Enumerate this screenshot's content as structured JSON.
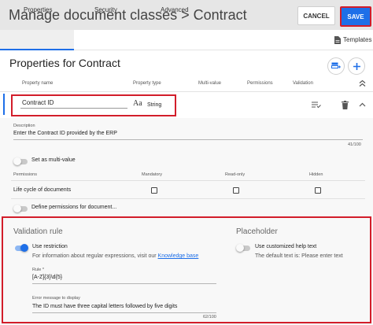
{
  "header": {
    "title": "Manage document classes > Contract",
    "cancel_label": "CANCEL",
    "save_label": "SAVE"
  },
  "tabs": [
    {
      "label": "Properties",
      "active": true
    },
    {
      "label": "Security",
      "active": false
    },
    {
      "label": "Advanced",
      "active": false
    }
  ],
  "templates_label": "Templates",
  "section_title": "Properties for Contract",
  "columns": {
    "name": "Property name",
    "type": "Property type",
    "multi": "Multi-value",
    "permissions": "Permissions",
    "validation": "Validation"
  },
  "property": {
    "name": "Contract ID",
    "type": "String",
    "type_icon": "Aa"
  },
  "description": {
    "label": "Description",
    "value": "Enter the Contract ID provided by the ERP",
    "counter": "41/100"
  },
  "multi_value": {
    "label": "Set as multi-value",
    "enabled": false
  },
  "permissions": {
    "header": "Permissions",
    "columns": [
      "Mandatory",
      "Read-only",
      "Hidden"
    ],
    "rows": [
      {
        "label": "Life cycle of documents",
        "mandatory": false,
        "read_only": false,
        "hidden": false
      }
    ]
  },
  "define_permissions": {
    "label": "Define permissions for document...",
    "enabled": false
  },
  "validation": {
    "title": "Validation rule",
    "use_restriction_label": "Use restriction",
    "use_restriction": true,
    "info_text": "For information about regular expressions, visit our ",
    "info_link": "Knowledge base",
    "rule_label": "Rule *",
    "rule_value": "[A-Z]{3}\\d{5}",
    "error_label": "Error message to display",
    "error_value": "The ID must have three capital letters followed by five digits",
    "error_counter": "62/100"
  },
  "placeholder": {
    "title": "Placeholder",
    "custom_label": "Use customized help text",
    "custom_enabled": false,
    "default_text": "The default text is: Please enter text"
  },
  "colors": {
    "accent": "#1e6fe8",
    "highlight": "#d21d2a"
  }
}
